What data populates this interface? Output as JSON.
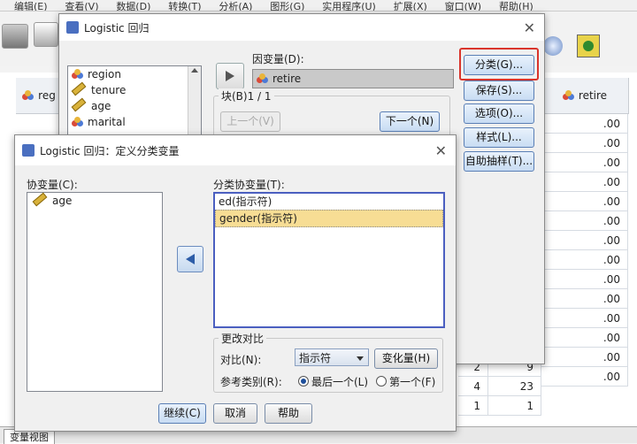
{
  "menubar": [
    "编辑(E)",
    "查看(V)",
    "数据(D)",
    "转换(T)",
    "分析(A)",
    "图形(G)",
    "实用程序(U)",
    "扩展(X)",
    "窗口(W)",
    "帮助(H)"
  ],
  "background": {
    "col_header_left": "reg",
    "col_header_retire": "retire",
    "retire_values": [
      ".00",
      ".00",
      ".00",
      ".00",
      ".00",
      ".00",
      ".00",
      ".00",
      ".00",
      ".00",
      ".00",
      ".00",
      ".00",
      ".00"
    ],
    "mid_col_a": [
      "2",
      "4",
      "1"
    ],
    "mid_col_b": [
      "9",
      "23",
      "1"
    ],
    "bottom_tab": "变量视图"
  },
  "main_dialog": {
    "title": "Logistic 回归",
    "variables": [
      "region",
      "tenure",
      "age",
      "marital"
    ],
    "dependent_label": "因变量(D):",
    "dependent_value": "retire",
    "block_label": "块(B)1 / 1",
    "prev_btn": "上一个(V)",
    "next_btn": "下一个(N)",
    "side_buttons": [
      "分类(G)...",
      "保存(S)...",
      "选项(O)...",
      "样式(L)...",
      "自助抽样(T)..."
    ]
  },
  "sub_dialog": {
    "title": "Logistic 回归：定义分类变量",
    "covariates_label": "协变量(C):",
    "covariates": [
      "age"
    ],
    "cat_label": "分类协变量(T):",
    "cat_items": [
      "ed(指示符)",
      "gender(指示符)"
    ],
    "change_group": "更改对比",
    "contrast_label": "对比(N):",
    "contrast_value": "指示符",
    "change_btn": "变化量(H)",
    "ref_label": "参考类别(R):",
    "ref_last": "最后一个(L)",
    "ref_first": "第一个(F)",
    "buttons": [
      "继续(C)",
      "取消",
      "帮助"
    ]
  },
  "colors": {
    "highlight": "#f7dd94",
    "accent_blue": "#1d4e9a",
    "red_box": "#d9342b"
  }
}
